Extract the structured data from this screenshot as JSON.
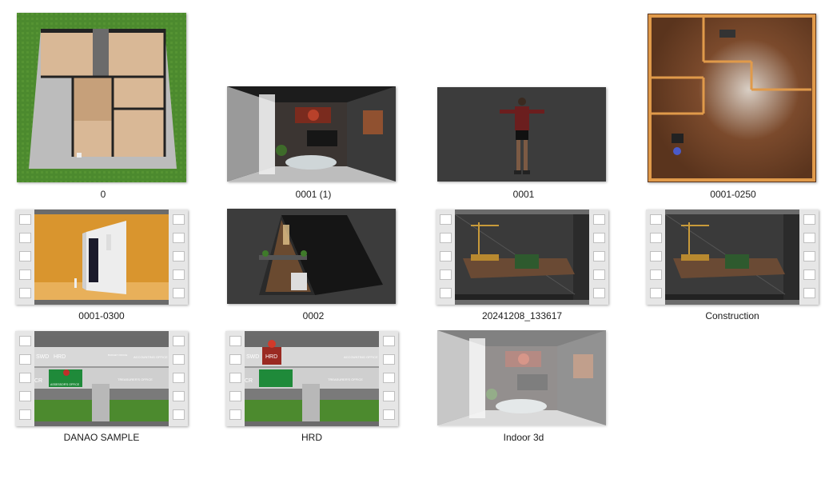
{
  "files": [
    {
      "name": "0",
      "kind": "image",
      "icon": "floorplan-thumbnail-icon"
    },
    {
      "name": "0001 (1)",
      "kind": "image",
      "icon": "interior-render-thumbnail-icon"
    },
    {
      "name": "0001",
      "kind": "image",
      "icon": "character-tpose-thumbnail-icon"
    },
    {
      "name": "0001-0250",
      "kind": "image",
      "icon": "wood-floorplan-thumbnail-icon"
    },
    {
      "name": "0001-0300",
      "kind": "video",
      "icon": "video-thumbnail-icon"
    },
    {
      "name": "0002",
      "kind": "image",
      "icon": "a-frame-house-thumbnail-icon"
    },
    {
      "name": "20241208_133617",
      "kind": "video",
      "icon": "video-thumbnail-icon"
    },
    {
      "name": "Construction",
      "kind": "video",
      "icon": "video-thumbnail-icon"
    },
    {
      "name": "DANAO SAMPLE",
      "kind": "video",
      "icon": "video-thumbnail-icon"
    },
    {
      "name": "HRD",
      "kind": "video",
      "icon": "video-thumbnail-icon"
    },
    {
      "name": "Indoor 3d",
      "kind": "image",
      "icon": "interior-render-thumbnail-icon"
    }
  ],
  "thumb_text": {
    "swd": "SWD",
    "hrd": "HRD",
    "assessors": "ASSESSOR'S OFFICE",
    "treasurers": "TREASURER'S OFFICE",
    "accounting": "ACCOUNTING OFFICE",
    "budget": "BUDGET OFFICE",
    "cr": "CR"
  },
  "colors": {
    "film_bg": "#6b6b6b",
    "hole_strip": "#e6e6e6",
    "viewport_gray": "#3a3a3a",
    "grass": "#4c8a2e",
    "orange_bg": "#d9952e",
    "wood_floor": "#7a4a2a"
  }
}
